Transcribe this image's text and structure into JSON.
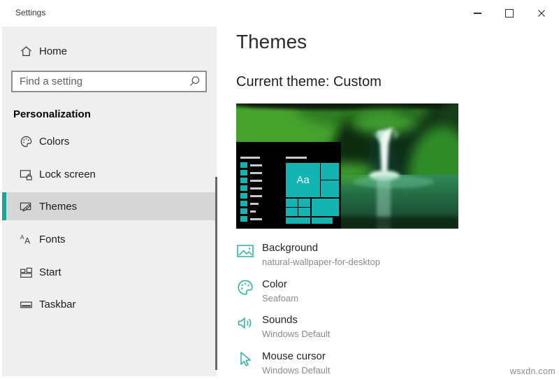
{
  "window": {
    "title": "Settings",
    "controls": [
      "minimize-icon",
      "maximize-icon",
      "close-icon"
    ]
  },
  "watermark": "wsxdn.com",
  "colors": {
    "accent": "#1aa396",
    "tile": "#12b5b1",
    "icon": "#2bb0a5",
    "panel_line": "#c9c9c9"
  },
  "sidebar": {
    "home_label": "Home",
    "search_placeholder": "Find a setting",
    "section_label": "Personalization",
    "items": [
      {
        "label": "Colors",
        "icon": "palette-icon"
      },
      {
        "label": "Lock screen",
        "icon": "lock-screen-icon"
      },
      {
        "label": "Themes",
        "icon": "themes-icon",
        "selected": true
      },
      {
        "label": "Fonts",
        "icon": "fonts-icon"
      },
      {
        "label": "Start",
        "icon": "start-icon"
      },
      {
        "label": "Taskbar",
        "icon": "taskbar-icon"
      }
    ]
  },
  "main": {
    "title": "Themes",
    "subtitle": "Current theme: Custom",
    "preview": {
      "tile_label": "Aa"
    },
    "settings": [
      {
        "label": "Background",
        "value": "natural-wallpaper-for-desktop",
        "icon": "image-icon"
      },
      {
        "label": "Color",
        "value": "Seafoam",
        "icon": "palette-icon"
      },
      {
        "label": "Sounds",
        "value": "Windows Default",
        "icon": "speaker-icon"
      },
      {
        "label": "Mouse cursor",
        "value": "Windows Default",
        "icon": "cursor-icon"
      }
    ]
  }
}
